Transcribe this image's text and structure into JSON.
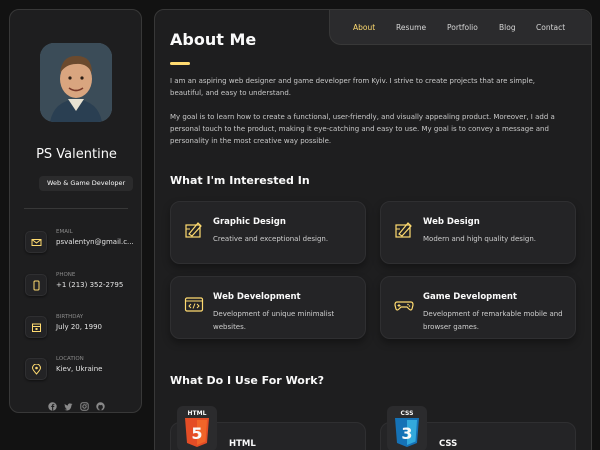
{
  "profile": {
    "name": "PS Valentine",
    "title": "Web & Game Developer"
  },
  "contacts": [
    {
      "label": "Email",
      "value": "psvalentyn@gmail.c...",
      "icon": "mail-icon"
    },
    {
      "label": "Phone",
      "value": "+1 (213) 352-2795",
      "icon": "phone-icon"
    },
    {
      "label": "Birthday",
      "value": "July 20, 1990",
      "icon": "calendar-icon"
    },
    {
      "label": "Location",
      "value": "Kiev, Ukraine",
      "icon": "location-pin-icon"
    }
  ],
  "socials": [
    "facebook-icon",
    "twitter-icon",
    "instagram-icon",
    "github-icon"
  ],
  "nav": {
    "items": [
      "About",
      "Resume",
      "Portfolio",
      "Blog",
      "Contact"
    ],
    "active": "About"
  },
  "about": {
    "heading": "About Me",
    "paragraphs": [
      "I am an aspiring web designer and game developer from Kyiv. I strive to create projects that are simple, beautiful, and easy to understand.",
      "My goal is to learn how to create a functional, user-friendly, and visually appealing product. Moreover, I add a personal touch to the product, making it eye-catching and easy to use. My goal is to convey a message and personality in the most creative way possible."
    ]
  },
  "interests": {
    "heading": "What I'm Interested In",
    "items": [
      {
        "title": "Graphic Design",
        "desc": "Creative and exceptional design.",
        "icon": "design-pen-icon"
      },
      {
        "title": "Web Design",
        "desc": "Modern and high quality design.",
        "icon": "design-pen-icon"
      },
      {
        "title": "Web Development",
        "desc": "Development of unique minimalist websites.",
        "icon": "code-window-icon"
      },
      {
        "title": "Game Development",
        "desc": "Development of remarkable mobile and browser games.",
        "icon": "gamepad-icon"
      }
    ]
  },
  "tools": {
    "heading": "What Do I Use For Work?",
    "items": [
      {
        "name": "HTML",
        "logo_text": "HTML",
        "color": "#e44d26"
      },
      {
        "name": "CSS",
        "logo_text": "CSS",
        "color": "#1572b6"
      }
    ]
  },
  "colors": {
    "accent": "#ffdb70",
    "background": "#121212",
    "card": "#1e1e1f"
  }
}
